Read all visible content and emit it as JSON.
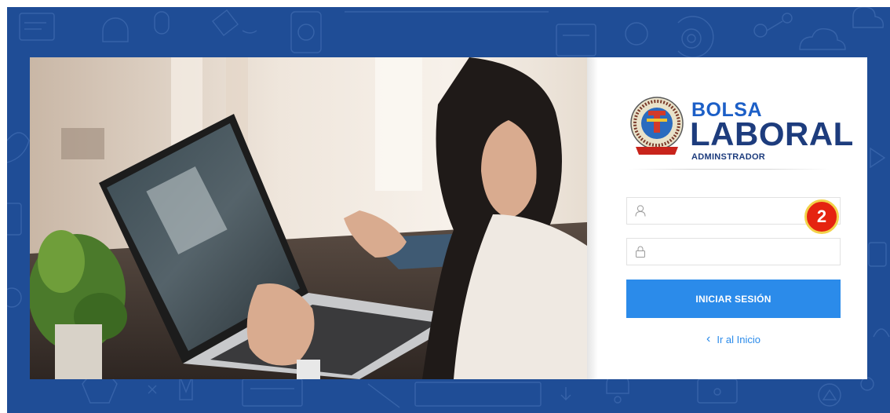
{
  "brand": {
    "line1": "BOLSA",
    "line2": "LABORAL",
    "line3": "ADMINSTRADOR",
    "seal_text": "NASCA"
  },
  "form": {
    "username_placeholder": "",
    "password_placeholder": "",
    "submit_label": "INICIAR SESIÓN",
    "back_label": "Ir al Inicio",
    "back_icon": "chevron-left-icon"
  },
  "annotation": {
    "step": "2"
  },
  "colors": {
    "background": "#1f4d96",
    "primary_button": "#2b8bea",
    "brand_light": "#1c5fc7",
    "brand_dark": "#1d3c7d",
    "badge": "#e52310"
  }
}
